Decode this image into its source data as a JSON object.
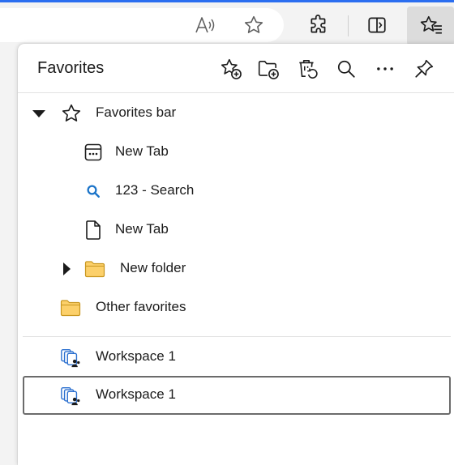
{
  "toolbar": {
    "icons": [
      "read-aloud-icon",
      "add-favorite-star-icon",
      "extensions-icon",
      "split-screen-icon",
      "favorites-icon"
    ]
  },
  "panel": {
    "title": "Favorites",
    "header_icons": [
      "add-favorite-icon",
      "add-folder-icon",
      "recycle-bin-icon",
      "search-icon",
      "more-options-icon",
      "pin-icon"
    ]
  },
  "favorites": {
    "bar": {
      "label": "Favorites bar",
      "expanded": true,
      "icon": "star-outline-icon"
    },
    "items": [
      {
        "label": "New Tab",
        "icon": "new-tab-page-icon"
      },
      {
        "label": "123 - Search",
        "icon": "search-favicon-icon"
      },
      {
        "label": "New Tab",
        "icon": "page-icon"
      },
      {
        "label": "New folder",
        "icon": "folder-icon",
        "collapsed": true
      }
    ],
    "other": {
      "label": "Other favorites",
      "icon": "folder-icon"
    }
  },
  "workspaces": [
    {
      "label": "Workspace 1",
      "icon": "workspace-icon"
    },
    {
      "label": "Workspace 1",
      "icon": "workspace-icon",
      "focused": true
    }
  ],
  "colors": {
    "accent": "#2b6ef0",
    "folder_fill": "#fcd06a",
    "folder_stroke": "#c8961e",
    "search_blue": "#1a73c8",
    "workspace_blue": "#2a6fcf"
  }
}
